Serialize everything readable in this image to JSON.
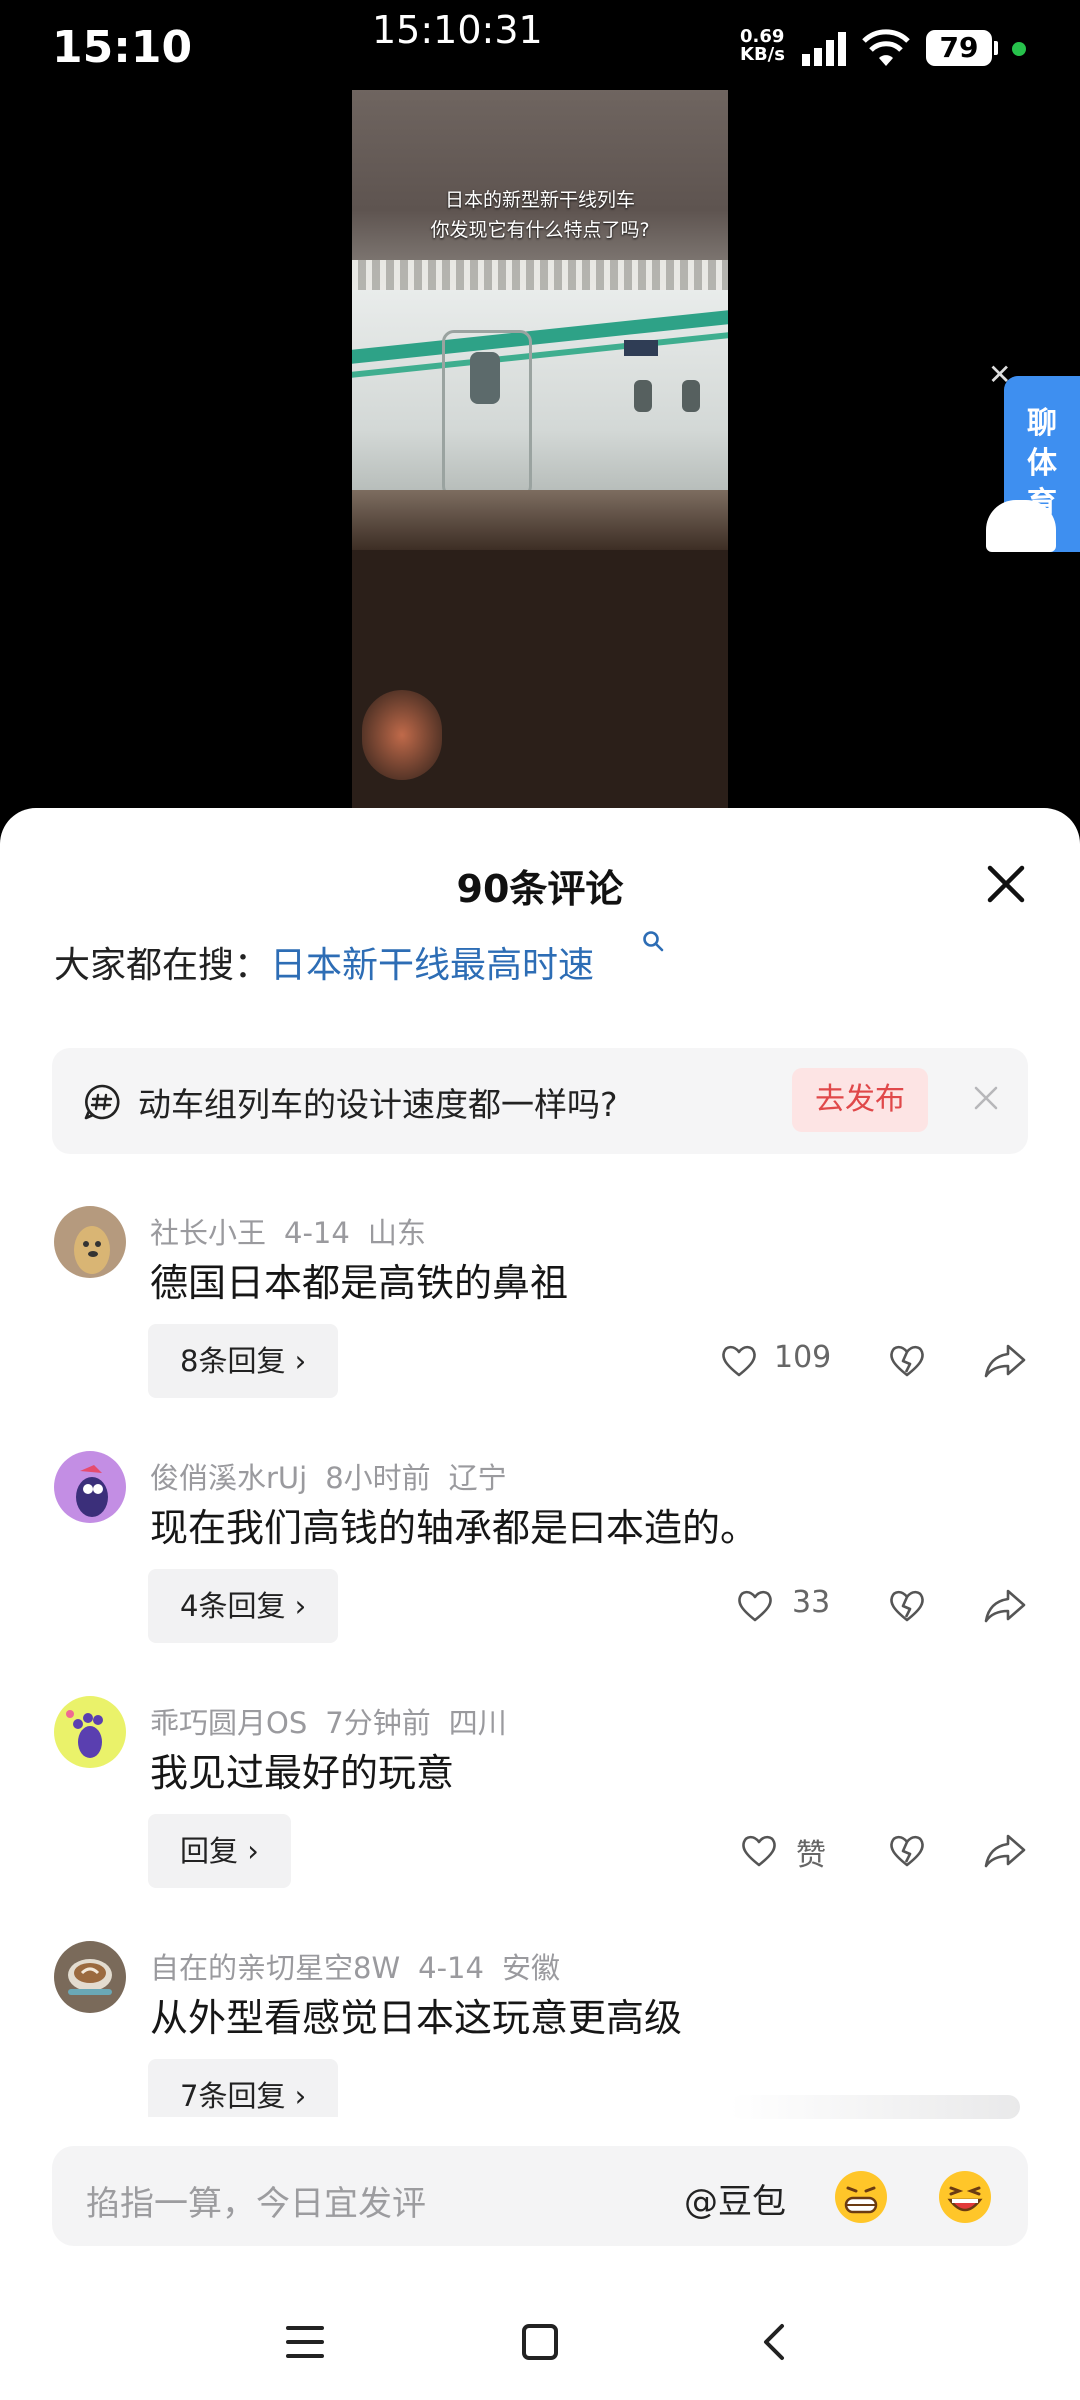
{
  "status_bar": {
    "time": "15:10",
    "clock": "15:10:31",
    "net_rate_value": "0.69",
    "net_rate_unit": "KB/s",
    "battery": "79"
  },
  "video": {
    "caption_line1": "日本的新型新干线列车",
    "caption_line2": "你发现它有什么特点了吗?"
  },
  "float_ad": {
    "label": "聊\n体\n育"
  },
  "sheet": {
    "title": "90条评论",
    "search_prefix": "大家都在搜：",
    "search_link": "日本新干线最高时速",
    "topic_text": "动车组列车的设计速度都一样吗?",
    "topic_button": "去发布"
  },
  "comments": [
    {
      "user": "社长小王",
      "time": "4-14",
      "location": "山东",
      "text": "德国日本都是高铁的鼻祖",
      "reply_label": "8条回复",
      "likes": "109"
    },
    {
      "user": "俊俏溪水rUj",
      "time": "8小时前",
      "location": "辽宁",
      "text": "现在我们高钱的轴承都是曰本造的。",
      "reply_label": "4条回复",
      "likes": "33"
    },
    {
      "user": "乖巧圆月OS",
      "time": "7分钟前",
      "location": "四川",
      "text": "我见过最好的玩意",
      "reply_label": "回复",
      "likes": "赞"
    },
    {
      "user": "自在的亲切星空8W",
      "time": "4-14",
      "location": "安徽",
      "text": "从外型看感觉日本这玩意更高级",
      "reply_label": "7条回复"
    }
  ],
  "input_bar": {
    "placeholder": "掐指一算，今日宜发评",
    "mention": "@豆包"
  },
  "colors": {
    "link_blue": "#2d6db5",
    "publish_red": "#e0484a",
    "meta_gray": "#9a9a9e"
  }
}
